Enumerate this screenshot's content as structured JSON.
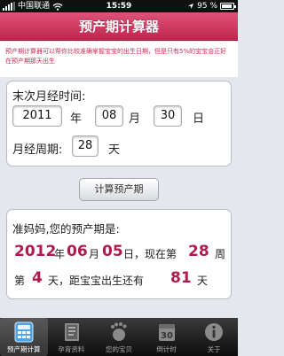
{
  "status_bar": {
    "carrier": "中国联通",
    "time": "15:59",
    "battery": "95 %"
  },
  "nav": {
    "title": "预产期计算器"
  },
  "notice": {
    "text": "预产期计算器可以帮你比较准确掌握宝宝的出生日期，但是只有5%的宝宝会正好在预产期那天出生"
  },
  "form": {
    "last_period_label": "末次月经时间:",
    "year": "2011",
    "year_unit": "年",
    "month": "08",
    "month_unit": "月",
    "day": "30",
    "day_unit": "日",
    "cycle_label": "月经周期:",
    "cycle": "28",
    "cycle_unit": "天"
  },
  "calc_button": "计算预产期",
  "result": {
    "heading": "准妈妈,您的预产期是:",
    "due_year": "2012",
    "year_unit": "年",
    "due_month": "06",
    "month_unit": "月",
    "due_day": "05",
    "day_unit": "日，现在第",
    "week": "28",
    "week_unit": "周",
    "week_prefix": "第",
    "day_no": "4",
    "remain_text": "天，距宝宝出生还有",
    "days_left": "81",
    "days_unit": "天"
  },
  "tabs": [
    {
      "label": "预产期计算",
      "icon": "calculator-icon"
    },
    {
      "label": "孕育资料",
      "icon": "book-icon"
    },
    {
      "label": "您的宝贝",
      "icon": "footprint-icon"
    },
    {
      "label": "倒计时",
      "icon": "calendar-icon"
    },
    {
      "label": "关于",
      "icon": "info-icon"
    }
  ]
}
